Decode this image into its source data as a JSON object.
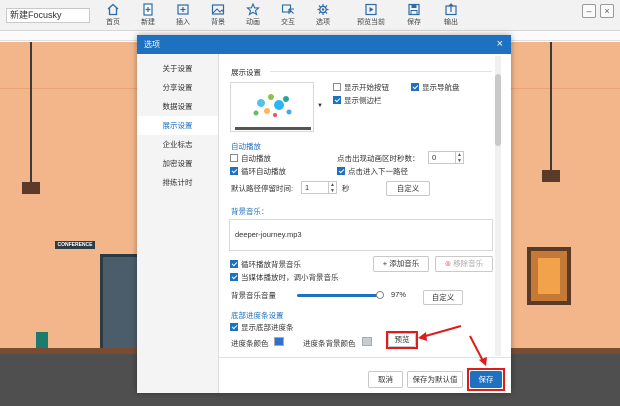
{
  "app": {
    "project_title": "新建Focusky"
  },
  "toolbar": {
    "items": [
      {
        "label": "首页",
        "icon": "home-icon"
      },
      {
        "label": "新建",
        "icon": "new-file-icon"
      },
      {
        "label": "插入",
        "icon": "insert-icon"
      },
      {
        "label": "背景",
        "icon": "background-icon"
      },
      {
        "label": "动画",
        "icon": "animation-star-icon"
      },
      {
        "label": "交互",
        "icon": "interaction-icon"
      },
      {
        "label": "选项",
        "icon": "gear-icon"
      },
      {
        "label": "预览当前",
        "icon": "preview-icon"
      },
      {
        "label": "保存",
        "icon": "save-icon"
      },
      {
        "label": "输出",
        "icon": "export-icon"
      }
    ]
  },
  "stage": {
    "sign_text": "CONFERENCE"
  },
  "dialog": {
    "title": "选项",
    "close": "×",
    "nav": [
      "关于设置",
      "分享设置",
      "数据设置",
      "展示设置",
      "企业标志",
      "加密设置",
      "排练计时"
    ],
    "active_nav_index": 3,
    "display_settings": {
      "section_title": "展示设置",
      "thumb_arrow": "▼",
      "checkboxes": [
        {
          "label": "显示开始按钮",
          "checked": false
        },
        {
          "label": "显示导航盘",
          "checked": true
        },
        {
          "label": "显示侧边栏",
          "checked": true
        }
      ]
    },
    "autoplay": {
      "section_title": "自动播放",
      "autoplay": {
        "label": "自动播放",
        "checked": false
      },
      "loop": {
        "label": "循环自动播放",
        "checked": true
      },
      "click_label": "点击出现动画区时秒数：",
      "click_value": "0",
      "click_next": {
        "label": "点击进入下一路径",
        "checked": true
      },
      "stay_label": "默认路径停留时间:",
      "stay_value": "1",
      "stay_unit": "秒",
      "custom_button": "自定义"
    },
    "music": {
      "section_title": "背景音乐：",
      "track": "deeper-journey.mp3",
      "loop": {
        "label": "循环播放背景音乐",
        "checked": true
      },
      "lower_on_media": {
        "label": "当媒体播放时，调小背景音乐",
        "checked": true
      },
      "add_button": "添加音乐",
      "remove_button": "移除音乐",
      "volume_label": "背景音乐音量",
      "volume_value": "97%",
      "volume_level": 0.97,
      "custom_button": "自定义"
    },
    "progress": {
      "section_title": "底部进度条设置",
      "show_bar": {
        "label": "显示底部进度条",
        "checked": true
      },
      "color_label": "进度条颜色",
      "bg_color_label": "进度条背景颜色",
      "preview_button": "预览",
      "bar_color": "#2f6fd0",
      "bg_color": "#9aa0a6"
    },
    "footer": {
      "cancel": "取消",
      "save_default": "保存为默认值",
      "save": "保存"
    }
  },
  "colors": {
    "accent": "#1e70c1",
    "highlight": "#e01b1b"
  }
}
